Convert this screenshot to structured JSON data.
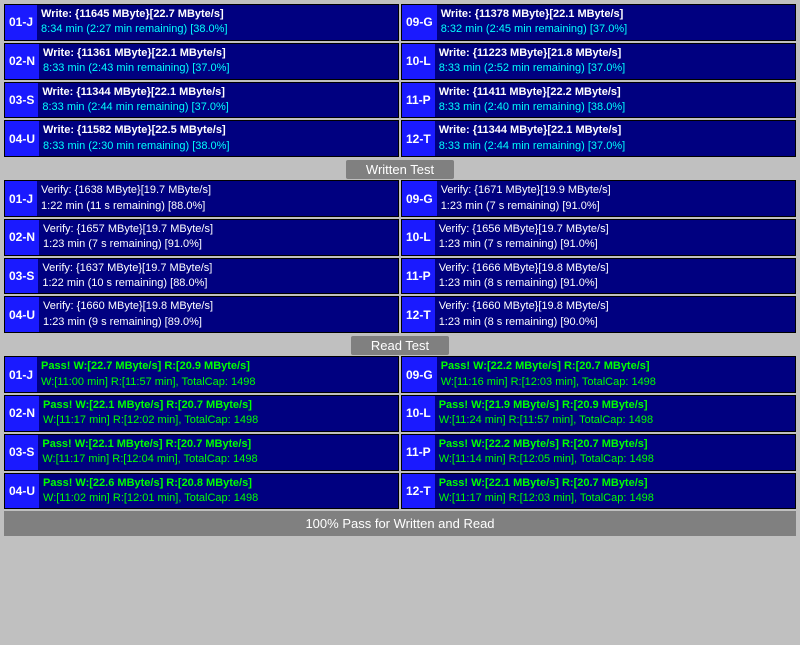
{
  "sections": {
    "written_test": {
      "label": "Written Test",
      "left": [
        {
          "id": "01-J",
          "line1": "Write: {11645 MByte}[22.7 MByte/s]",
          "line2": "8:34 min (2:27 min remaining)  [38.0%]"
        },
        {
          "id": "02-N",
          "line1": "Write: {11361 MByte}[22.1 MByte/s]",
          "line2": "8:33 min (2:43 min remaining)  [37.0%]"
        },
        {
          "id": "03-S",
          "line1": "Write: {11344 MByte}[22.1 MByte/s]",
          "line2": "8:33 min (2:44 min remaining)  [37.0%]"
        },
        {
          "id": "04-U",
          "line1": "Write: {11582 MByte}[22.5 MByte/s]",
          "line2": "8:33 min (2:30 min remaining)  [38.0%]"
        }
      ],
      "right": [
        {
          "id": "09-G",
          "line1": "Write: {11378 MByte}[22.1 MByte/s]",
          "line2": "8:32 min (2:45 min remaining)  [37.0%]"
        },
        {
          "id": "10-L",
          "line1": "Write: {11223 MByte}[21.8 MByte/s]",
          "line2": "8:33 min (2:52 min remaining)  [37.0%]"
        },
        {
          "id": "11-P",
          "line1": "Write: {11411 MByte}[22.2 MByte/s]",
          "line2": "8:33 min (2:40 min remaining)  [38.0%]"
        },
        {
          "id": "12-T",
          "line1": "Write: {11344 MByte}[22.1 MByte/s]",
          "line2": "8:33 min (2:44 min remaining)  [37.0%]"
        }
      ]
    },
    "verify_test": {
      "label": "Written Test",
      "left": [
        {
          "id": "01-J",
          "line1": "Verify: {1638 MByte}[19.7 MByte/s]",
          "line2": "1:22 min (11 s remaining)  [88.0%]"
        },
        {
          "id": "02-N",
          "line1": "Verify: {1657 MByte}[19.7 MByte/s]",
          "line2": "1:23 min (7 s remaining)  [91.0%]"
        },
        {
          "id": "03-S",
          "line1": "Verify: {1637 MByte}[19.7 MByte/s]",
          "line2": "1:22 min (10 s remaining)  [88.0%]"
        },
        {
          "id": "04-U",
          "line1": "Verify: {1660 MByte}[19.8 MByte/s]",
          "line2": "1:23 min (9 s remaining)  [89.0%]"
        }
      ],
      "right": [
        {
          "id": "09-G",
          "line1": "Verify: {1671 MByte}[19.9 MByte/s]",
          "line2": "1:23 min (7 s remaining)  [91.0%]"
        },
        {
          "id": "10-L",
          "line1": "Verify: {1656 MByte}[19.7 MByte/s]",
          "line2": "1:23 min (7 s remaining)  [91.0%]"
        },
        {
          "id": "11-P",
          "line1": "Verify: {1666 MByte}[19.8 MByte/s]",
          "line2": "1:23 min (8 s remaining)  [91.0%]"
        },
        {
          "id": "12-T",
          "line1": "Verify: {1660 MByte}[19.8 MByte/s]",
          "line2": "1:23 min (8 s remaining)  [90.0%]"
        }
      ]
    },
    "read_test": {
      "label": "Read Test",
      "left": [
        {
          "id": "01-J",
          "line1": "Pass! W:[22.7 MByte/s] R:[20.9 MByte/s]",
          "line2": "W:[11:00 min] R:[11:57 min], TotalCap: 1498"
        },
        {
          "id": "02-N",
          "line1": "Pass! W:[22.1 MByte/s] R:[20.7 MByte/s]",
          "line2": "W:[11:17 min] R:[12:02 min], TotalCap: 1498"
        },
        {
          "id": "03-S",
          "line1": "Pass! W:[22.1 MByte/s] R:[20.7 MByte/s]",
          "line2": "W:[11:17 min] R:[12:04 min], TotalCap: 1498"
        },
        {
          "id": "04-U",
          "line1": "Pass! W:[22.6 MByte/s] R:[20.8 MByte/s]",
          "line2": "W:[11:02 min] R:[12:01 min], TotalCap: 1498"
        }
      ],
      "right": [
        {
          "id": "09-G",
          "line1": "Pass! W:[22.2 MByte/s] R:[20.7 MByte/s]",
          "line2": "W:[11:16 min] R:[12:03 min], TotalCap: 1498"
        },
        {
          "id": "10-L",
          "line1": "Pass! W:[21.9 MByte/s] R:[20.9 MByte/s]",
          "line2": "W:[11:24 min] R:[11:57 min], TotalCap: 1498"
        },
        {
          "id": "11-P",
          "line1": "Pass! W:[22.2 MByte/s] R:[20.7 MByte/s]",
          "line2": "W:[11:14 min] R:[12:05 min], TotalCap: 1498"
        },
        {
          "id": "12-T",
          "line1": "Pass! W:[22.1 MByte/s] R:[20.7 MByte/s]",
          "line2": "W:[11:17 min] R:[12:03 min], TotalCap: 1498"
        }
      ]
    }
  },
  "footer": {
    "label": "100% Pass for Written and Read"
  },
  "dividers": {
    "written": "Written Test",
    "read": "Read Test"
  }
}
